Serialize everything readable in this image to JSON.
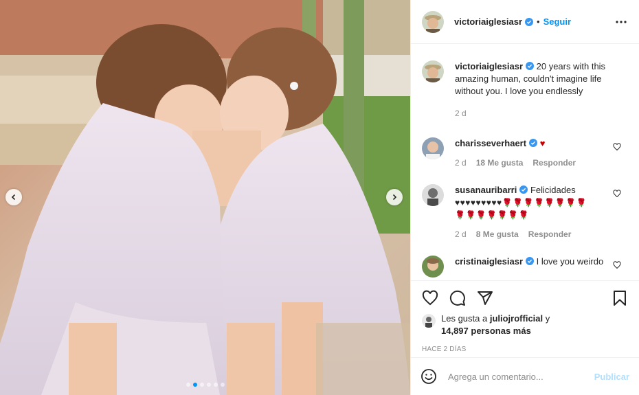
{
  "post": {
    "author": "victoriaiglesiasr",
    "follow_label": "Seguir",
    "separator": "•"
  },
  "caption": {
    "author": "victoriaiglesiasr",
    "text": "20 years with this amazing human, couldn't imagine life without you. I love you endlessly",
    "age": "2 d"
  },
  "comments": [
    {
      "user": "charisseverhaert",
      "text": "♥",
      "age": "2 d",
      "likes": "18 Me gusta",
      "reply": "Responder"
    },
    {
      "user": "susanauribarri",
      "text": "Felicidades",
      "emoji_line1": "♥♥♥♥♥♥♥♥♥",
      "roses1": "🌹🌹🌹🌹🌹🌹🌹🌹",
      "roses2": "🌹🌹🌹🌹🌹🌹🌹",
      "age": "2 d",
      "likes": "8 Me gusta",
      "reply": "Responder"
    },
    {
      "user": "cristinaiglesiasr",
      "text": "I love you weirdo"
    }
  ],
  "likes": {
    "prefix": "Les gusta a",
    "user": "juliojrofficial",
    "joiner": "y",
    "others": "14,897 personas más"
  },
  "timestamp": "HACE 2 DÍAS",
  "composer": {
    "placeholder": "Agrega un comentario...",
    "post_label": "Publicar"
  },
  "carousel": {
    "count": 6,
    "active_index": 1
  },
  "colors": {
    "accent": "#0095f6",
    "muted": "#8e8e8e",
    "publish_disabled": "#b2dffc"
  },
  "icons": [
    "more-icon",
    "verified-icon",
    "heart-icon",
    "comment-icon",
    "share-icon",
    "bookmark-icon",
    "smile-icon",
    "chevron-left-icon",
    "chevron-right-icon"
  ]
}
